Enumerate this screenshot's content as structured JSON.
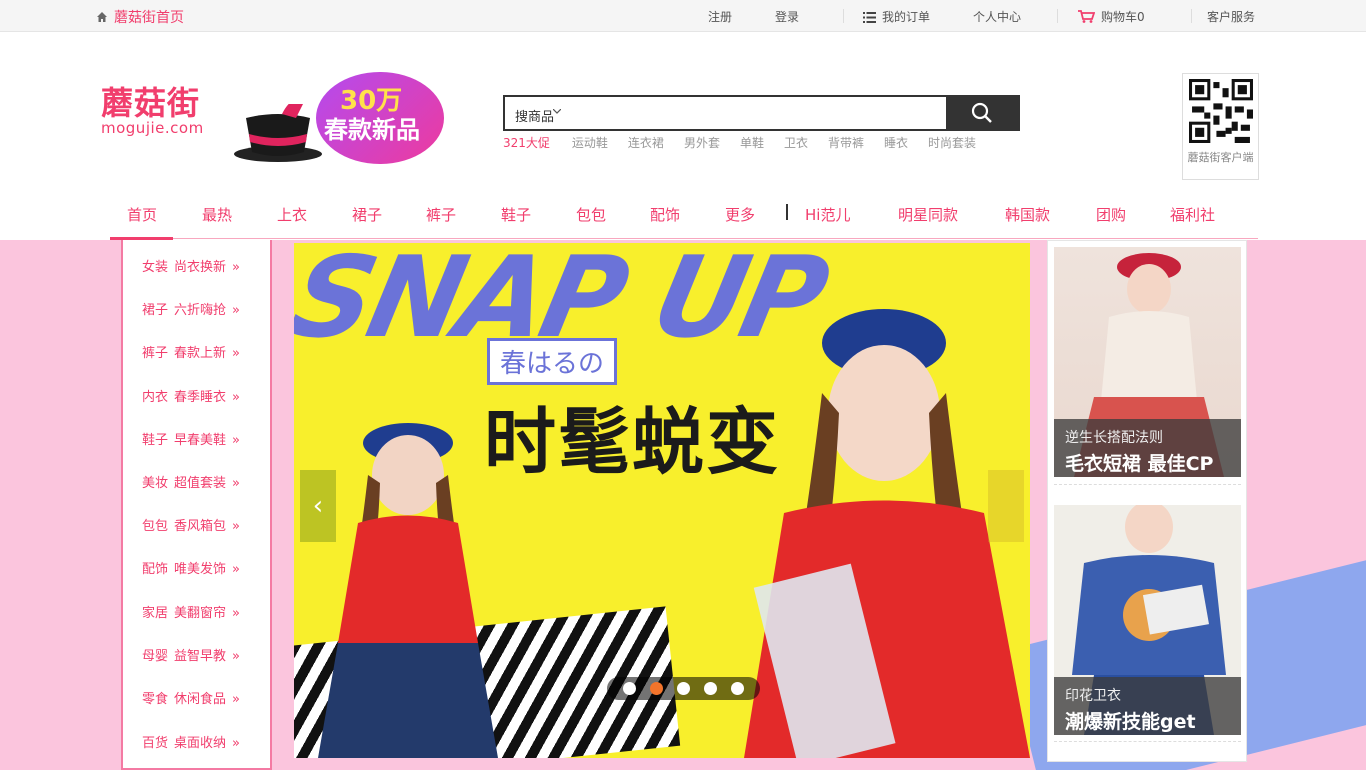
{
  "topbar": {
    "home": "蘑菇街首页",
    "register": "注册",
    "login": "登录",
    "orders": "我的订单",
    "account": "个人中心",
    "cart": "购物车0",
    "service": "客户服务"
  },
  "header": {
    "logo_cn": "蘑菇街",
    "logo_en": "mogujie.com",
    "promo_number": "30万",
    "promo_text": "春款新品"
  },
  "search": {
    "category": "搜商品",
    "placeholder": "",
    "hotwords": [
      "321大促",
      "运动鞋",
      "连衣裙",
      "男外套",
      "单鞋",
      "卫衣",
      "背带裤",
      "睡衣",
      "时尚套装"
    ]
  },
  "qr": {
    "caption": "蘑菇街客户端"
  },
  "nav": {
    "items": [
      "首页",
      "最热",
      "上衣",
      "裙子",
      "裤子",
      "鞋子",
      "包包",
      "配饰",
      "更多",
      "Hi范儿",
      "明星同款",
      "韩国款",
      "团购",
      "福利社"
    ]
  },
  "categories": [
    {
      "name": "女装",
      "tag": "尚衣换新"
    },
    {
      "name": "裙子",
      "tag": "六折嗨抢"
    },
    {
      "name": "裤子",
      "tag": "春款上新"
    },
    {
      "name": "内衣",
      "tag": "春季睡衣"
    },
    {
      "name": "鞋子",
      "tag": "早春美鞋"
    },
    {
      "name": "美妆",
      "tag": "超值套装"
    },
    {
      "name": "包包",
      "tag": "香风箱包"
    },
    {
      "name": "配饰",
      "tag": "唯美发饰"
    },
    {
      "name": "家居",
      "tag": "美翻窗帘"
    },
    {
      "name": "母婴",
      "tag": "益智早教"
    },
    {
      "name": "零食",
      "tag": "休闲食品"
    },
    {
      "name": "百货",
      "tag": "桌面收纳"
    }
  ],
  "banner": {
    "headline_en": "SNAP UP",
    "headline_jp": "春はるの",
    "headline_cn": "时髦蜕变",
    "slides_total": 5,
    "slide_active": 2
  },
  "cards": [
    {
      "sub": "逆生长搭配法则",
      "title": "毛衣短裙 最佳CP"
    },
    {
      "sub": "印花卫衣",
      "title": "潮爆新技能get"
    }
  ],
  "colors": {
    "brand": "#f13e6d",
    "bg_pink": "#fbc5dd",
    "banner_yellow": "#f8ef2c",
    "accent_purple": "#6b73d8"
  }
}
